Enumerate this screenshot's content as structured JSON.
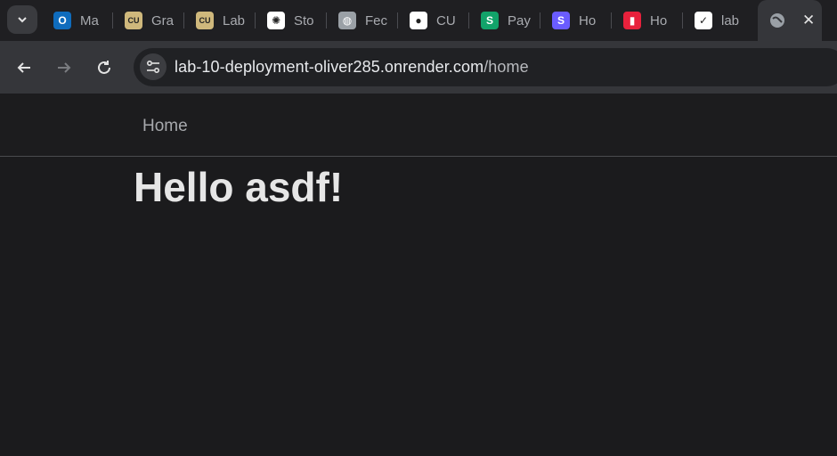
{
  "browser": {
    "tabs": [
      {
        "title": "Ma",
        "icon": "outlook-icon",
        "color": "#0f6cbd",
        "glyph": "O"
      },
      {
        "title": "Gra",
        "icon": "cu-logo-icon",
        "color": "#cfb87c",
        "glyph": "CU"
      },
      {
        "title": "Lab",
        "icon": "cu-logo-icon",
        "color": "#cfb87c",
        "glyph": "CU"
      },
      {
        "title": "Sto",
        "icon": "chatgpt-icon",
        "color": "#ffffff",
        "glyph": "✺"
      },
      {
        "title": "Fec",
        "icon": "globe-icon",
        "color": "#9aa0a6",
        "glyph": "◍"
      },
      {
        "title": "CU",
        "icon": "github-icon",
        "color": "#ffffff",
        "glyph": "●"
      },
      {
        "title": "Pay",
        "icon": "s-logo-icon",
        "color": "#12a36a",
        "glyph": "S"
      },
      {
        "title": "Ho",
        "icon": "s-logo-icon",
        "color": "#6a5cff",
        "glyph": "S"
      },
      {
        "title": "Ho",
        "icon": "bookmark-icon",
        "color": "#e8213c",
        "glyph": "▮"
      },
      {
        "title": "lab",
        "icon": "render-icon",
        "color": "#ffffff",
        "glyph": "✓"
      }
    ],
    "active_tab": {
      "icon": "globe-icon",
      "close_label": "✕"
    },
    "url_host": "lab-10-deployment-oliver285.onrender.com",
    "url_path": "/home"
  },
  "page": {
    "nav_home": "Home",
    "greeting": "Hello asdf!"
  }
}
